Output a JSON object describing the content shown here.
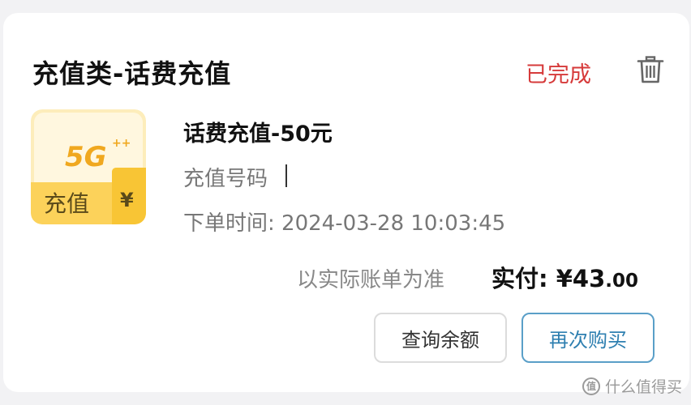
{
  "order": {
    "title": "充值类-话费充值",
    "status": "已完成",
    "status_color": "#d63a3a"
  },
  "product": {
    "image_icon": "5g-recharge-icon",
    "image_badge": "5G",
    "image_label": "充值",
    "image_currency": "¥",
    "name": "话费充值-50元",
    "recharge_number_label": "充值号码",
    "order_time": "下单时间: 2024-03-28 10:03:45"
  },
  "payment": {
    "note": "以实际账单为准",
    "paid_label": "实付:",
    "paid_main": "¥43",
    "paid_cents": ".00"
  },
  "actions": {
    "check_balance": "查询余额",
    "rebuy": "再次购买",
    "rebuy_color": "#2e7fb0"
  },
  "watermark": {
    "icon": "smzdm-logo-icon",
    "icon_glyph": "值",
    "text": "什么值得买"
  }
}
